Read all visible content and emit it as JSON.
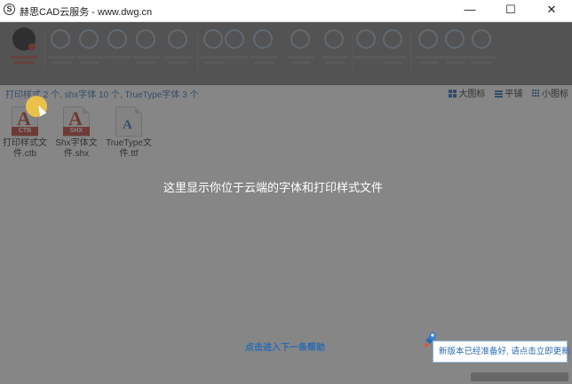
{
  "window": {
    "title": "赫思CAD云服务 - www.dwg.cn",
    "logo_letter": "S",
    "minimize": "—",
    "maximize": "☐",
    "close": "✕"
  },
  "toolbar": {
    "items": [
      "user-icon",
      "upload-icon",
      "cloud-icon",
      "share-icon",
      "refresh-icon",
      "sync-icon",
      "clock-icon",
      "folder-icon",
      "globe-icon",
      "font-icon",
      "grid-icon",
      "edit-icon",
      "text-icon",
      "key-icon",
      "chat-icon",
      "settings-icon"
    ]
  },
  "infobar": {
    "summary": "打印样式 2 个, shx字体 10 个, TrueType字体 3 个"
  },
  "view_options": {
    "large": "大图标",
    "tile": "平铺",
    "small": "小图标"
  },
  "files": [
    {
      "tag": "CTB",
      "name": "打印样式文件.ctb"
    },
    {
      "tag": "SHX",
      "name": "Shx字体文件.shx"
    },
    {
      "tag": "A",
      "name": "TrueType文件.ttf"
    }
  ],
  "tutorial": {
    "hint": "这里显示你位于云端的字体和打印样式文件",
    "next": "点击进入下一条帮助"
  },
  "update_popup": {
    "text": "新版本已经准备好, 请点击立即更新"
  },
  "colors": {
    "accent": "#2a6ab3",
    "brand_red": "#c0392b",
    "highlight": "#f5c842"
  }
}
